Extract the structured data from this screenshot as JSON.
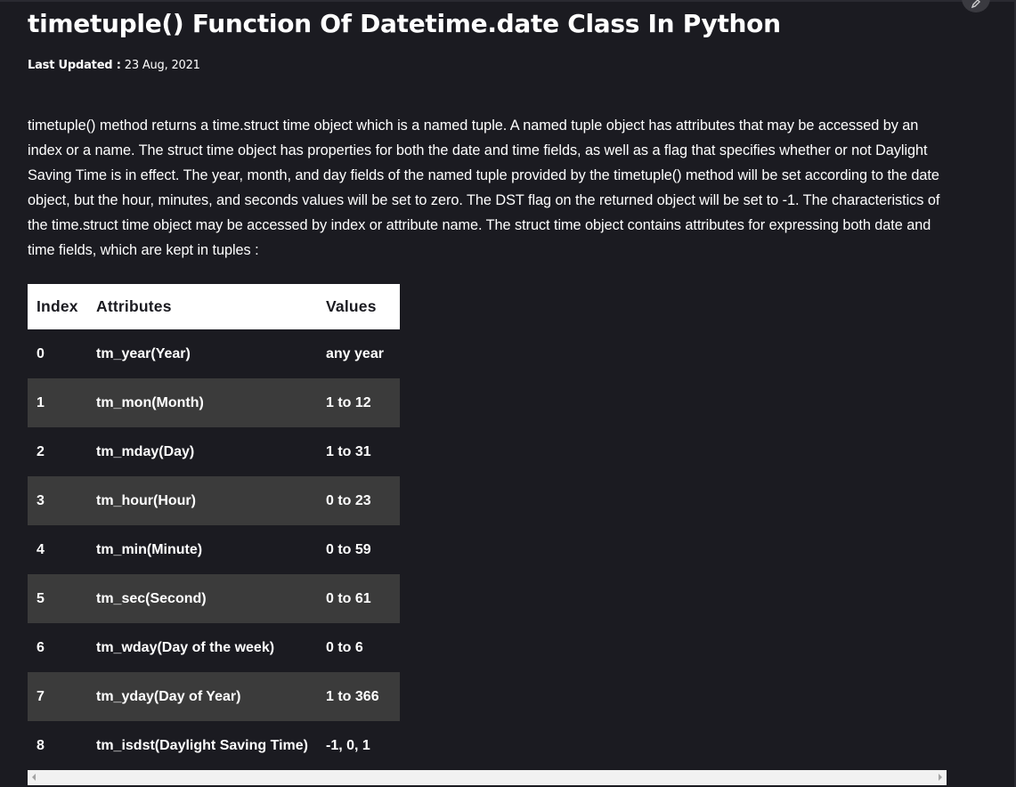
{
  "article": {
    "title": "timetuple() Function Of Datetime.date Class In Python",
    "last_updated_label": "Last Updated :",
    "last_updated_value": "23 Aug, 2021",
    "body": "timetuple() method returns a time.struct time object which is a named tuple. A named tuple object has attributes that may be accessed by an index or a name. The struct time object has properties for both the date and time fields, as well as a flag that specifies whether or not Daylight Saving Time is in effect. The year, month, and day fields of the named tuple provided by the timetuple() method will be set according to the date object, but the hour, minutes, and seconds values will be set to zero. The DST flag on the returned object will be set to -1. The characteristics of the time.struct time object may be accessed by index or attribute name. The struct time object contains attributes for expressing both date and time fields, which are kept in tuples :"
  },
  "table": {
    "headers": [
      "Index",
      "Attributes",
      "Values"
    ],
    "rows": [
      [
        "0",
        "tm_year(Year)",
        "any year"
      ],
      [
        "1",
        "tm_mon(Month)",
        "1 to 12"
      ],
      [
        "2",
        "tm_mday(Day)",
        "1 to 31"
      ],
      [
        "3",
        "tm_hour(Hour)",
        "0 to 23"
      ],
      [
        "4",
        "tm_min(Minute)",
        "0 to 59"
      ],
      [
        "5",
        "tm_sec(Second)",
        "0 to 61"
      ],
      [
        "6",
        "tm_wday(Day of the week)",
        "0 to 6"
      ],
      [
        "7",
        "tm_yday(Day of Year)",
        "1 to 366"
      ],
      [
        "8",
        "tm_isdst(Daylight Saving Time)",
        "-1, 0, 1"
      ]
    ]
  },
  "icons": {
    "corner": "edit-icon",
    "scroll_left": "chevron-left-icon",
    "scroll_right": "chevron-right-icon"
  },
  "colors": {
    "background": "#1b1b21",
    "table_header_bg": "#ffffff",
    "table_alt_row_bg": "#3b3b3b",
    "text": "#ffffff"
  }
}
